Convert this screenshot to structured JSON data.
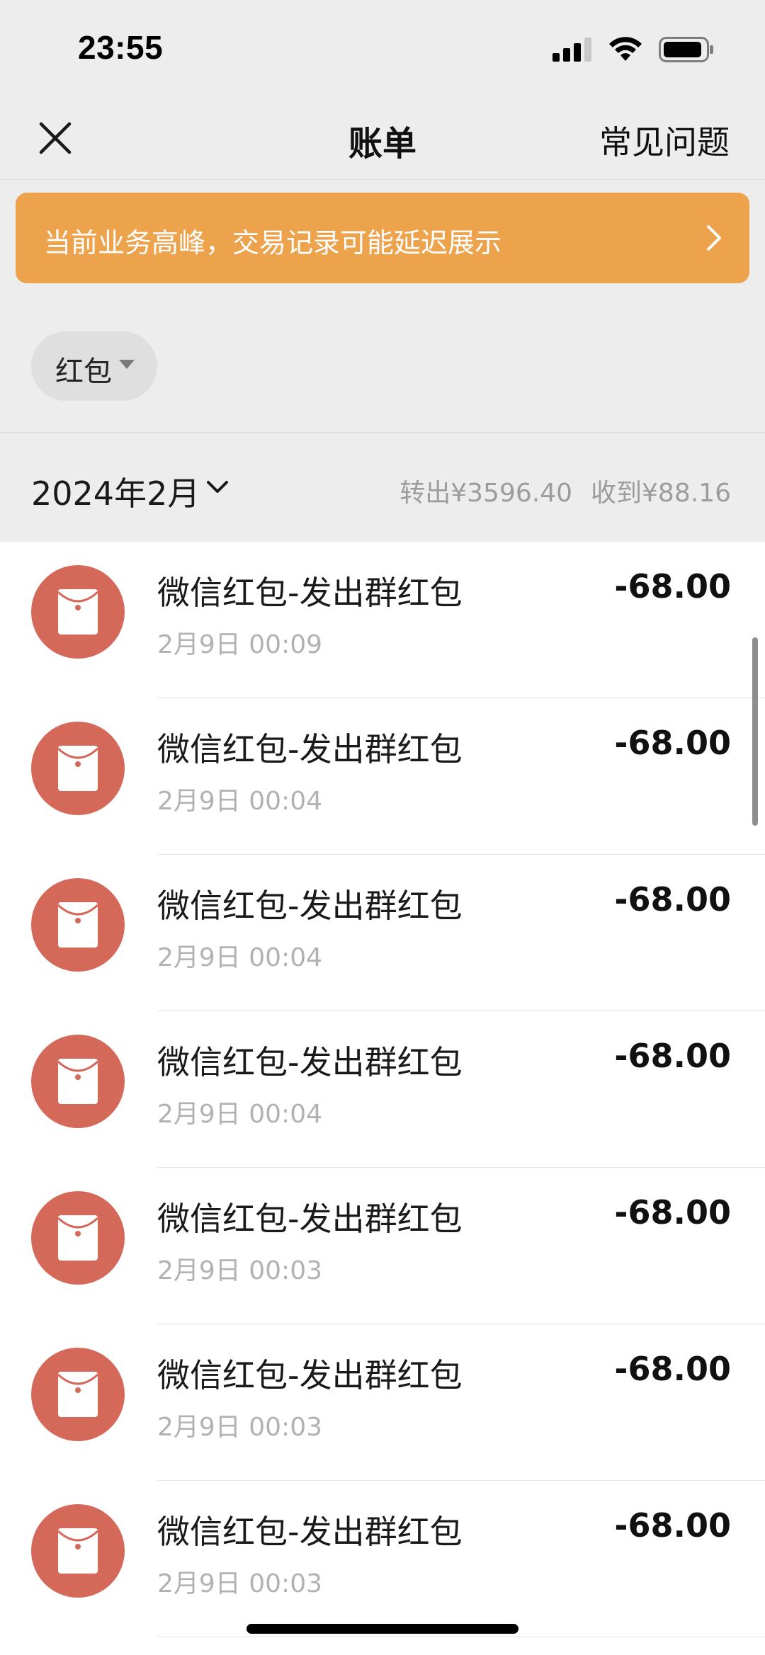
{
  "status_bar": {
    "time": "23:55"
  },
  "nav": {
    "title": "账单",
    "faq_label": "常见问题"
  },
  "notice": {
    "text": "当前业务高峰，交易记录可能延迟展示"
  },
  "filter": {
    "label": "红包"
  },
  "month": {
    "label": "2024年2月",
    "out_label": "转出",
    "out_amount": "¥3596.40",
    "in_label": "收到",
    "in_amount": "¥88.16"
  },
  "transactions": [
    {
      "title": "微信红包-发出群红包",
      "time": "2月9日 00:09",
      "amount": "-68.00"
    },
    {
      "title": "微信红包-发出群红包",
      "time": "2月9日 00:04",
      "amount": "-68.00"
    },
    {
      "title": "微信红包-发出群红包",
      "time": "2月9日 00:04",
      "amount": "-68.00"
    },
    {
      "title": "微信红包-发出群红包",
      "time": "2月9日 00:04",
      "amount": "-68.00"
    },
    {
      "title": "微信红包-发出群红包",
      "time": "2月9日 00:03",
      "amount": "-68.00"
    },
    {
      "title": "微信红包-发出群红包",
      "time": "2月9日 00:03",
      "amount": "-68.00"
    },
    {
      "title": "微信红包-发出群红包",
      "time": "2月9日 00:03",
      "amount": "-68.00"
    }
  ],
  "colors": {
    "banner": "#eda24c",
    "avatar": "#d4695a",
    "page_bg": "#ededed"
  },
  "icons": {
    "close": "close-icon",
    "chevron_right": "chevron-right-icon",
    "caret_down": "caret-down-icon",
    "chevron_down": "chevron-down-icon",
    "red_packet": "red-packet-icon"
  }
}
